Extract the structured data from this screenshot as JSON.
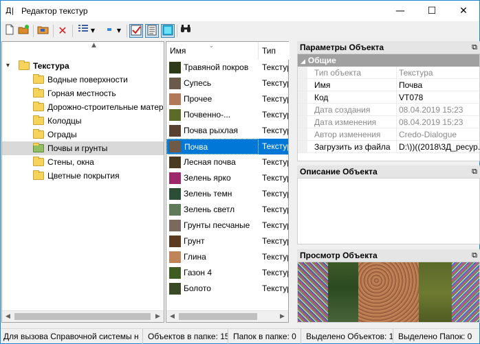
{
  "window": {
    "title": "Редактор текстур",
    "app_icon": "Д|",
    "minimize": "—",
    "maximize": "☐",
    "close": "✕"
  },
  "toolbar": {
    "icons": [
      "new-document-icon",
      "new-folder-icon",
      "open-folder-icon",
      "delete-icon",
      "view-list-icon",
      "dropdown-icon",
      "marker-icon",
      "dropdown-icon",
      "checkbox-icon",
      "properties-icon",
      "preview-icon",
      "find-icon"
    ]
  },
  "tree": {
    "root": "Текстура",
    "items": [
      "Водные поверхности",
      "Горная местность",
      "Дорожно-строительные матер",
      "Колодцы",
      "Ограды",
      "Почвы и грунты",
      "Стены, окна",
      "Цветные покрытия"
    ],
    "selected": "Почвы и грунты"
  },
  "list": {
    "col_name": "Имя",
    "col_type": "Тип",
    "rows": [
      {
        "name": "Травяной покров",
        "type": "Текстур",
        "color": "#2e3a17"
      },
      {
        "name": "Супесь",
        "type": "Текстур",
        "color": "#6b5a4a"
      },
      {
        "name": "Прочее",
        "type": "Текстур",
        "color": "#b07a5a"
      },
      {
        "name": "Почвенно-...",
        "type": "Текстур",
        "color": "#5d6b2a"
      },
      {
        "name": "Почва рыхлая",
        "type": "Текстур",
        "color": "#5a4030"
      },
      {
        "name": "Почва",
        "type": "Текстур",
        "color": "#6f5a48"
      },
      {
        "name": "Лесная почва",
        "type": "Текстур",
        "color": "#4a3a22"
      },
      {
        "name": "Зелень ярко",
        "type": "Текстур",
        "color": "#9a2a6a"
      },
      {
        "name": "Зелень темн",
        "type": "Текстур",
        "color": "#2d4e36"
      },
      {
        "name": "Зелень светл",
        "type": "Текстур",
        "color": "#5e7a58"
      },
      {
        "name": "Грунты песчаные",
        "type": "Текстур",
        "color": "#7a6a5e"
      },
      {
        "name": "Грунт",
        "type": "Текстур",
        "color": "#5a3a20"
      },
      {
        "name": "Глина",
        "type": "Текстур",
        "color": "#c0845a"
      },
      {
        "name": "Газон 4",
        "type": "Текстур",
        "color": "#3f5c22"
      },
      {
        "name": "Болото",
        "type": "Текстур",
        "color": "#3a4a26"
      }
    ],
    "selected": "Почва"
  },
  "props_panel": {
    "title": "Параметры Объекта",
    "category": "Общие",
    "rows": [
      {
        "name": "Тип объекта",
        "value": "Текстура",
        "readonly": true
      },
      {
        "name": "Имя",
        "value": "Почва",
        "readonly": false
      },
      {
        "name": "Код",
        "value": "VT078",
        "readonly": false
      },
      {
        "name": "Дата создания",
        "value": "08.04.2019 15:23",
        "readonly": true
      },
      {
        "name": "Дата изменения",
        "value": "08.04.2019 15:23",
        "readonly": true
      },
      {
        "name": "Автор изменения",
        "value": "Credo-Dialogue",
        "readonly": true
      },
      {
        "name": "Загрузить из файла",
        "value": "D:\\))((2018\\3Д_ресур...",
        "readonly": false
      }
    ]
  },
  "desc_panel": {
    "title": "Описание Объекта"
  },
  "preview_panel": {
    "title": "Просмотр Объекта"
  },
  "status": {
    "help": "Для вызова Справочной системы н",
    "objects_in_folder": "Объектов в папке: 15",
    "folders_in_folder": "Папок в папке: 0",
    "selected_objects": "Выделено Объектов: 1",
    "selected_folders": "Выделено Папок: 0"
  }
}
